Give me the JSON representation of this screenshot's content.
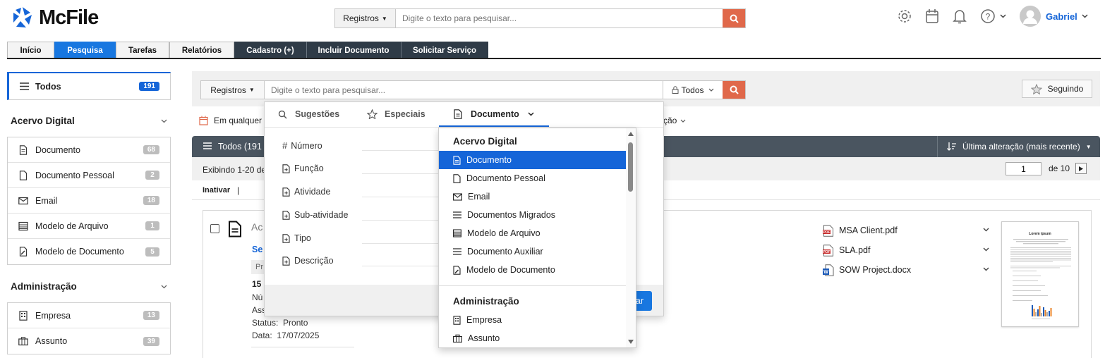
{
  "app": {
    "name": "McFile",
    "user": "Gabriel"
  },
  "top_search": {
    "scope": "Registros",
    "placeholder": "Digite o texto para pesquisar..."
  },
  "tabs": [
    "Início",
    "Pesquisa",
    "Tarefas",
    "Relatórios",
    "Cadastro (+)",
    "Incluir Documento",
    "Solicitar Serviço"
  ],
  "active_tab": "Pesquisa",
  "sidebar": {
    "all": {
      "label": "Todos",
      "count": "191"
    },
    "sections": [
      {
        "title": "Acervo Digital",
        "items": [
          {
            "label": "Documento",
            "count": "68"
          },
          {
            "label": "Documento Pessoal",
            "count": "2"
          },
          {
            "label": "Email",
            "count": "18"
          },
          {
            "label": "Modelo de Arquivo",
            "count": "1"
          },
          {
            "label": "Modelo de Documento",
            "count": "5"
          }
        ]
      },
      {
        "title": "Administração",
        "items": [
          {
            "label": "Empresa",
            "count": "13"
          },
          {
            "label": "Assunto",
            "count": "39"
          }
        ]
      }
    ]
  },
  "search": {
    "scope": "Registros",
    "placeholder": "Digite o texto para pesquisar...",
    "filter": "Todos",
    "follow": "Seguindo"
  },
  "filters": {
    "date": "Em qualquer",
    "partial_right": "ção"
  },
  "results": {
    "header": "Todos (191",
    "sort": "Última alteração (mais recente)",
    "showing": "Exibindo 1-20 de",
    "page": "1",
    "page_of": "de 10",
    "action": "Inativar",
    "sep": "|"
  },
  "item": {
    "title_partial": "Ac",
    "link_partial": "Se",
    "badge_partial": "Pr",
    "date_partial": "15",
    "f1": "Nú",
    "f2": "Ass",
    "status": "Status:  Pronto",
    "date": "Data:  17/07/2025",
    "files": [
      "MSA Client.pdf",
      "SLA.pdf",
      "SOW Project.docx"
    ],
    "thumb_title": "Lorem ipsum",
    "button_partial": "ar"
  },
  "suggest": {
    "tabs": [
      "Sugestões",
      "Especiais",
      "Documento"
    ],
    "fields": [
      "Número",
      "Função",
      "Atividade",
      "Sub-atividade",
      "Tipo",
      "Descrição"
    ]
  },
  "dropdown": {
    "groups": [
      {
        "title": "Acervo Digital",
        "items": [
          "Documento",
          "Documento Pessoal",
          "Email",
          "Documentos Migrados",
          "Modelo de Arquivo",
          "Documento Auxiliar",
          "Modelo de Documento"
        ]
      },
      {
        "title": "Administração",
        "items": [
          "Empresa",
          "Assunto"
        ]
      }
    ],
    "selected": "Documento"
  },
  "colors": {
    "accent": "#1565d8",
    "search_btn": "#e0684a",
    "dark_bar": "#4a5560",
    "tab_dark": "#2f3b47"
  }
}
